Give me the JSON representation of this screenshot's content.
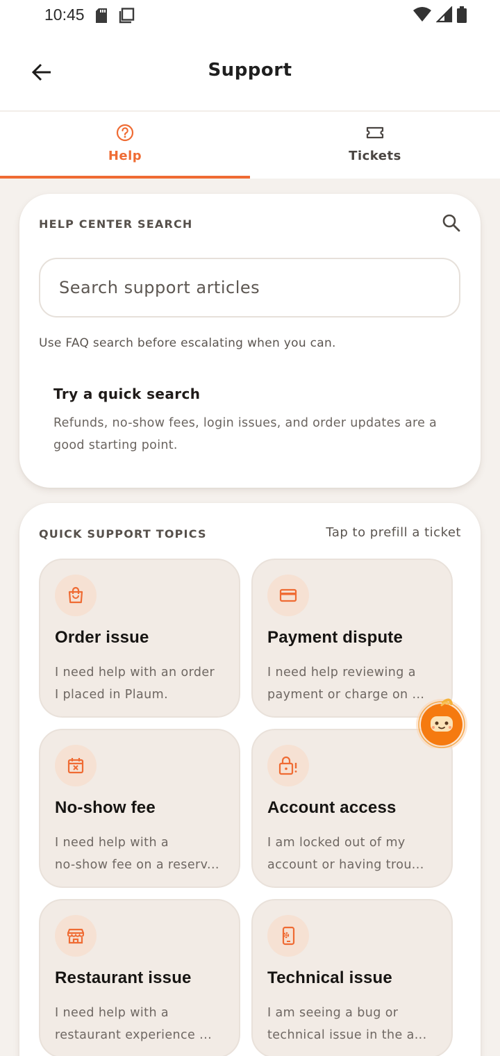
{
  "status_bar": {
    "time": "10:45"
  },
  "header": {
    "title": "Support"
  },
  "tabs": [
    {
      "label": "Help",
      "icon": "help-circle-icon",
      "active": true
    },
    {
      "label": "Tickets",
      "icon": "ticket-icon",
      "active": false
    }
  ],
  "search_card": {
    "section_label": "HELP CENTER SEARCH",
    "search_placeholder": "Search support articles",
    "search_value": "",
    "hint": "Use FAQ search before escalating when you can.",
    "quick_title": "Try a quick search",
    "quick_desc": "Refunds, no-show fees, login issues, and order updates are a good starting point."
  },
  "topics_card": {
    "section_label": "QUICK SUPPORT TOPICS",
    "hint": "Tap to prefill a ticket",
    "tiles": [
      {
        "title": "Order issue",
        "icon": "shopping-bag-icon",
        "desc_line1": "I need help with an order",
        "desc_line2": "I placed in Plaum."
      },
      {
        "title": "Payment dispute",
        "icon": "credit-card-icon",
        "desc_line1": "I need help reviewing a",
        "desc_line2": "payment or charge on ..."
      },
      {
        "title": "No-show fee",
        "icon": "calendar-x-icon",
        "desc_line1": "I need help with a",
        "desc_line2": "no-show fee on a reserv..."
      },
      {
        "title": "Account access",
        "icon": "lock-alert-icon",
        "desc_line1": "I am locked out of my",
        "desc_line2": "account or having trou..."
      },
      {
        "title": "Restaurant issue",
        "icon": "storefront-icon",
        "desc_line1": "I need help with a",
        "desc_line2": "restaurant experience ..."
      },
      {
        "title": "Technical issue",
        "icon": "phone-settings-icon",
        "desc_line1": "I am seeing a bug or",
        "desc_line2": "technical issue in the a..."
      }
    ]
  },
  "colors": {
    "accent": "#ef6b33",
    "tile_bg": "#f2ebe5",
    "page_bg": "#f5f1ed",
    "icon_circle": "#f6e1d3"
  }
}
